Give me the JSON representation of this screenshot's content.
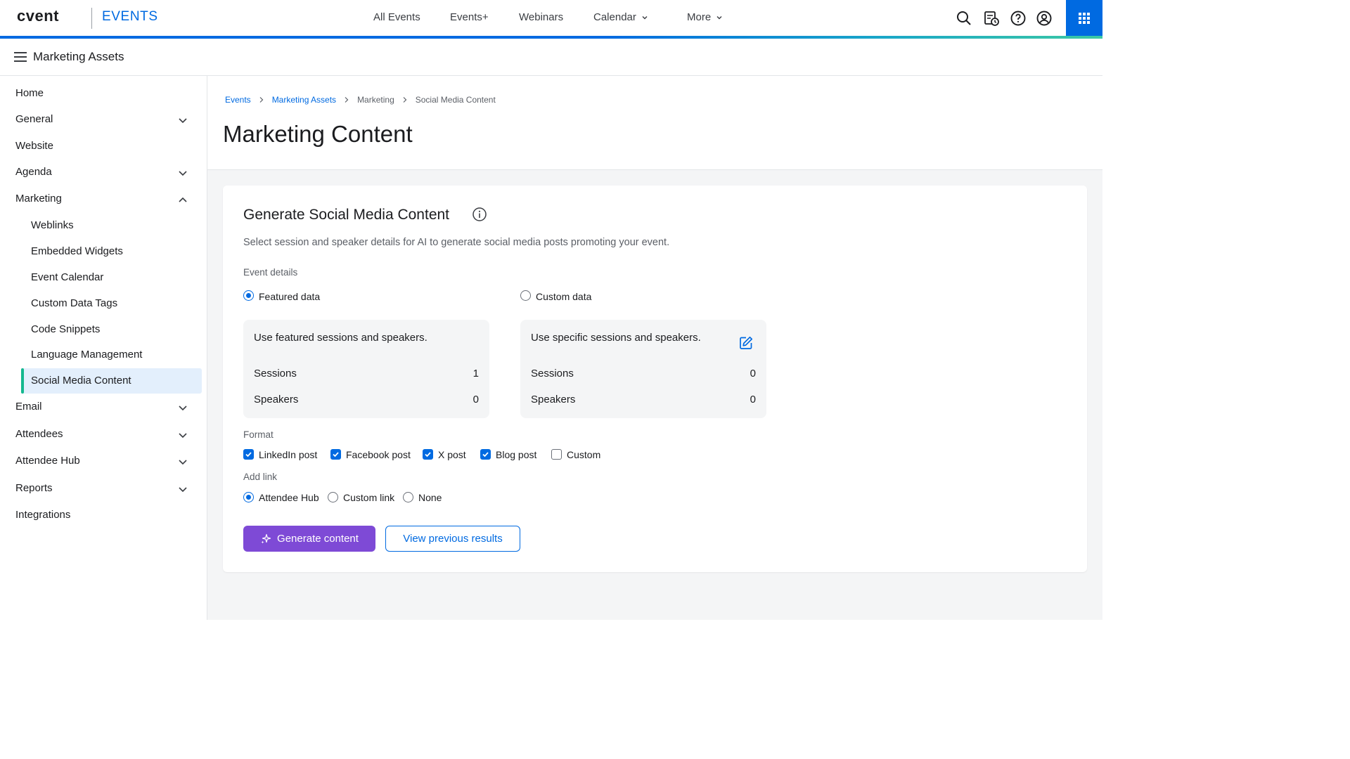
{
  "header": {
    "logo": "cvent",
    "app_name": "EVENTS",
    "nav": [
      {
        "label": "All Events"
      },
      {
        "label": "Events+"
      },
      {
        "label": "Webinars"
      },
      {
        "label": "Calendar"
      },
      {
        "label": "More"
      }
    ],
    "icons": [
      "search-icon",
      "calendar-check-icon",
      "help-icon",
      "user-icon",
      "apps-grid-icon"
    ],
    "accent": "#006ae1"
  },
  "subbar": {
    "title": "Marketing Assets"
  },
  "sidebar": {
    "items": [
      {
        "label": "Home"
      },
      {
        "label": "General"
      },
      {
        "label": "Website"
      },
      {
        "label": "Agenda"
      },
      {
        "label": "Marketing"
      },
      {
        "label": "Weblinks"
      },
      {
        "label": "Embedded Widgets"
      },
      {
        "label": "Event Calendar"
      },
      {
        "label": "Custom Data Tags"
      },
      {
        "label": "Code Snippets"
      },
      {
        "label": "Language Management"
      },
      {
        "label": "Social Media Content"
      },
      {
        "label": "Email"
      },
      {
        "label": "Attendees"
      },
      {
        "label": "Attendee Hub"
      },
      {
        "label": "Reports"
      },
      {
        "label": "Integrations"
      }
    ],
    "active": "Social Media Content"
  },
  "breadcrumb": [
    "Events",
    "Marketing Assets",
    "Marketing",
    "Social Media Content"
  ],
  "page_title": "Marketing Content",
  "card": {
    "title": "Generate Social Media Content",
    "description": "Select session and speaker details for AI to generate social media posts promoting your event.",
    "event_details_label": "Event details",
    "featured": {
      "option_label": "Featured data",
      "selected": true,
      "heading": "Use featured sessions and speakers.",
      "sessions_label": "Sessions",
      "sessions_value": "1",
      "speakers_label": "Speakers",
      "speakers_value": "0"
    },
    "custom": {
      "option_label": "Custom data",
      "selected": false,
      "heading": "Use specific sessions and speakers.",
      "sessions_label": "Sessions",
      "sessions_value": "0",
      "speakers_label": "Speakers",
      "speakers_value": "0"
    },
    "format_label": "Format",
    "formats": [
      {
        "label": "LinkedIn post",
        "checked": true
      },
      {
        "label": "Facebook post",
        "checked": true
      },
      {
        "label": "X post",
        "checked": true
      },
      {
        "label": "Blog post",
        "checked": true
      },
      {
        "label": "Custom",
        "checked": false
      }
    ],
    "add_link_label": "Add link",
    "links": [
      {
        "label": "Attendee Hub",
        "selected": true
      },
      {
        "label": "Custom link",
        "selected": false
      },
      {
        "label": "None",
        "selected": false
      }
    ],
    "generate_button": "Generate content",
    "view_button": "View previous results",
    "button_color": "#7e4ad6"
  }
}
